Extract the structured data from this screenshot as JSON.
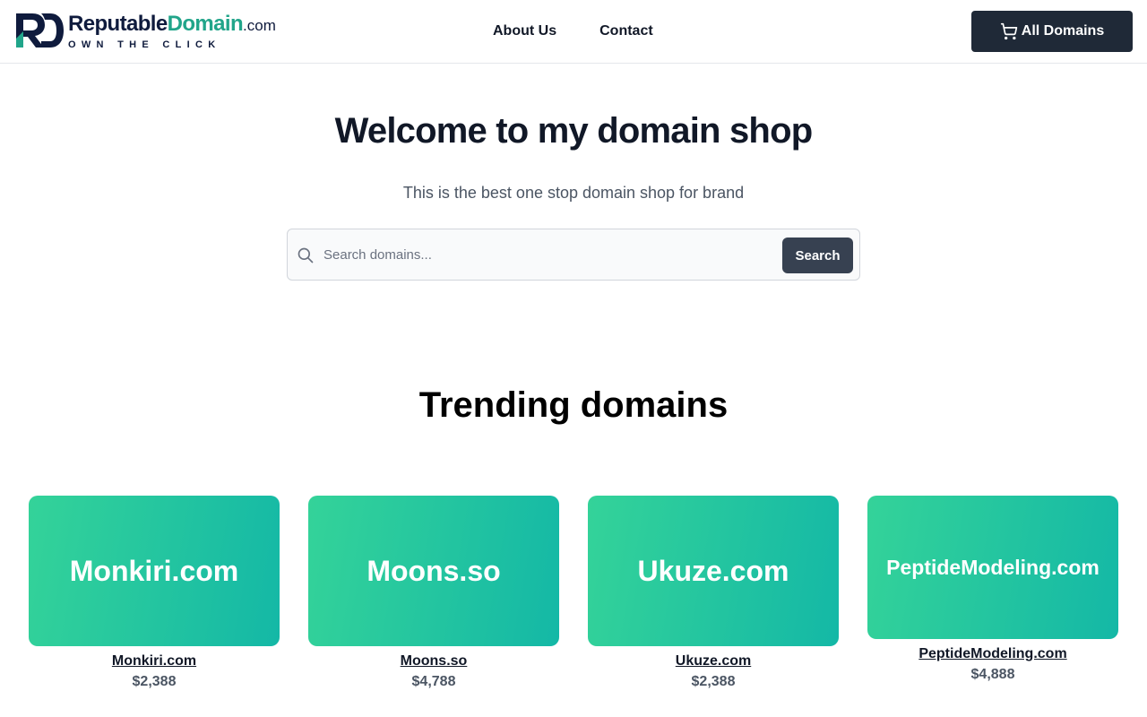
{
  "header": {
    "logo": {
      "name_part1": "Reputable",
      "name_part2": "Domain",
      "tld": ".com",
      "tagline": "OWN THE CLICK"
    },
    "nav": [
      {
        "label": "About Us"
      },
      {
        "label": "Contact"
      }
    ],
    "cta_label": "All Domains"
  },
  "hero": {
    "title": "Welcome to my domain shop",
    "subtitle": "This is the best one stop domain shop for brand",
    "search": {
      "placeholder": "Search domains...",
      "value": "",
      "button_label": "Search"
    }
  },
  "trending": {
    "title": "Trending domains",
    "items": [
      {
        "name": "Monkiri.com",
        "price": "$2,388"
      },
      {
        "name": "Moons.so",
        "price": "$4,788"
      },
      {
        "name": "Ukuze.com",
        "price": "$2,388"
      },
      {
        "name": "PeptideModeling.com",
        "price": "$4,888"
      }
    ]
  },
  "colors": {
    "brand_dark": "#0f1b3d",
    "brand_green": "#21a58a",
    "button_dark": "#1f2937",
    "card_gradient_start": "#34d399",
    "card_gradient_end": "#14b8a6"
  },
  "icons": {
    "cart": "cart-icon",
    "search": "search-icon",
    "logo": "logo-mark-icon"
  }
}
